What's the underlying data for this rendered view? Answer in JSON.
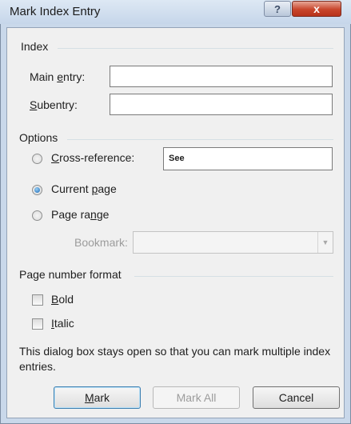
{
  "window": {
    "title": "Mark Index Entry",
    "help_label": "?",
    "close_label": "x"
  },
  "index": {
    "group_label": "Index",
    "main_entry": {
      "label_pre": "Main ",
      "label_key": "e",
      "label_post": "ntry:",
      "value": ""
    },
    "subentry": {
      "label_pre": "",
      "label_key": "S",
      "label_post": "ubentry:",
      "value": ""
    }
  },
  "options": {
    "group_label": "Options",
    "cross_reference": {
      "label_pre": "",
      "label_key": "C",
      "label_post": "ross-reference:",
      "value": "See",
      "selected": false
    },
    "current_page": {
      "label_pre": "Current ",
      "label_key": "p",
      "label_post": "age",
      "selected": true
    },
    "page_range": {
      "label_pre": "Page ra",
      "label_key": "n",
      "label_post": "ge",
      "selected": false
    },
    "bookmark": {
      "label": "Bookmark:",
      "value": "",
      "enabled": false
    }
  },
  "page_number_format": {
    "group_label": "Page number format",
    "bold": {
      "label_pre": "",
      "label_key": "B",
      "label_post": "old",
      "checked": false
    },
    "italic": {
      "label_pre": "",
      "label_key": "I",
      "label_post": "talic",
      "checked": false
    }
  },
  "info_text": "This dialog box stays open so that you can mark multiple index entries.",
  "buttons": {
    "mark": {
      "label_pre": "",
      "label_key": "M",
      "label_post": "ark"
    },
    "mark_all": "Mark All",
    "cancel": "Cancel"
  },
  "icons": {
    "combo_arrow": "chevron-down-icon"
  }
}
